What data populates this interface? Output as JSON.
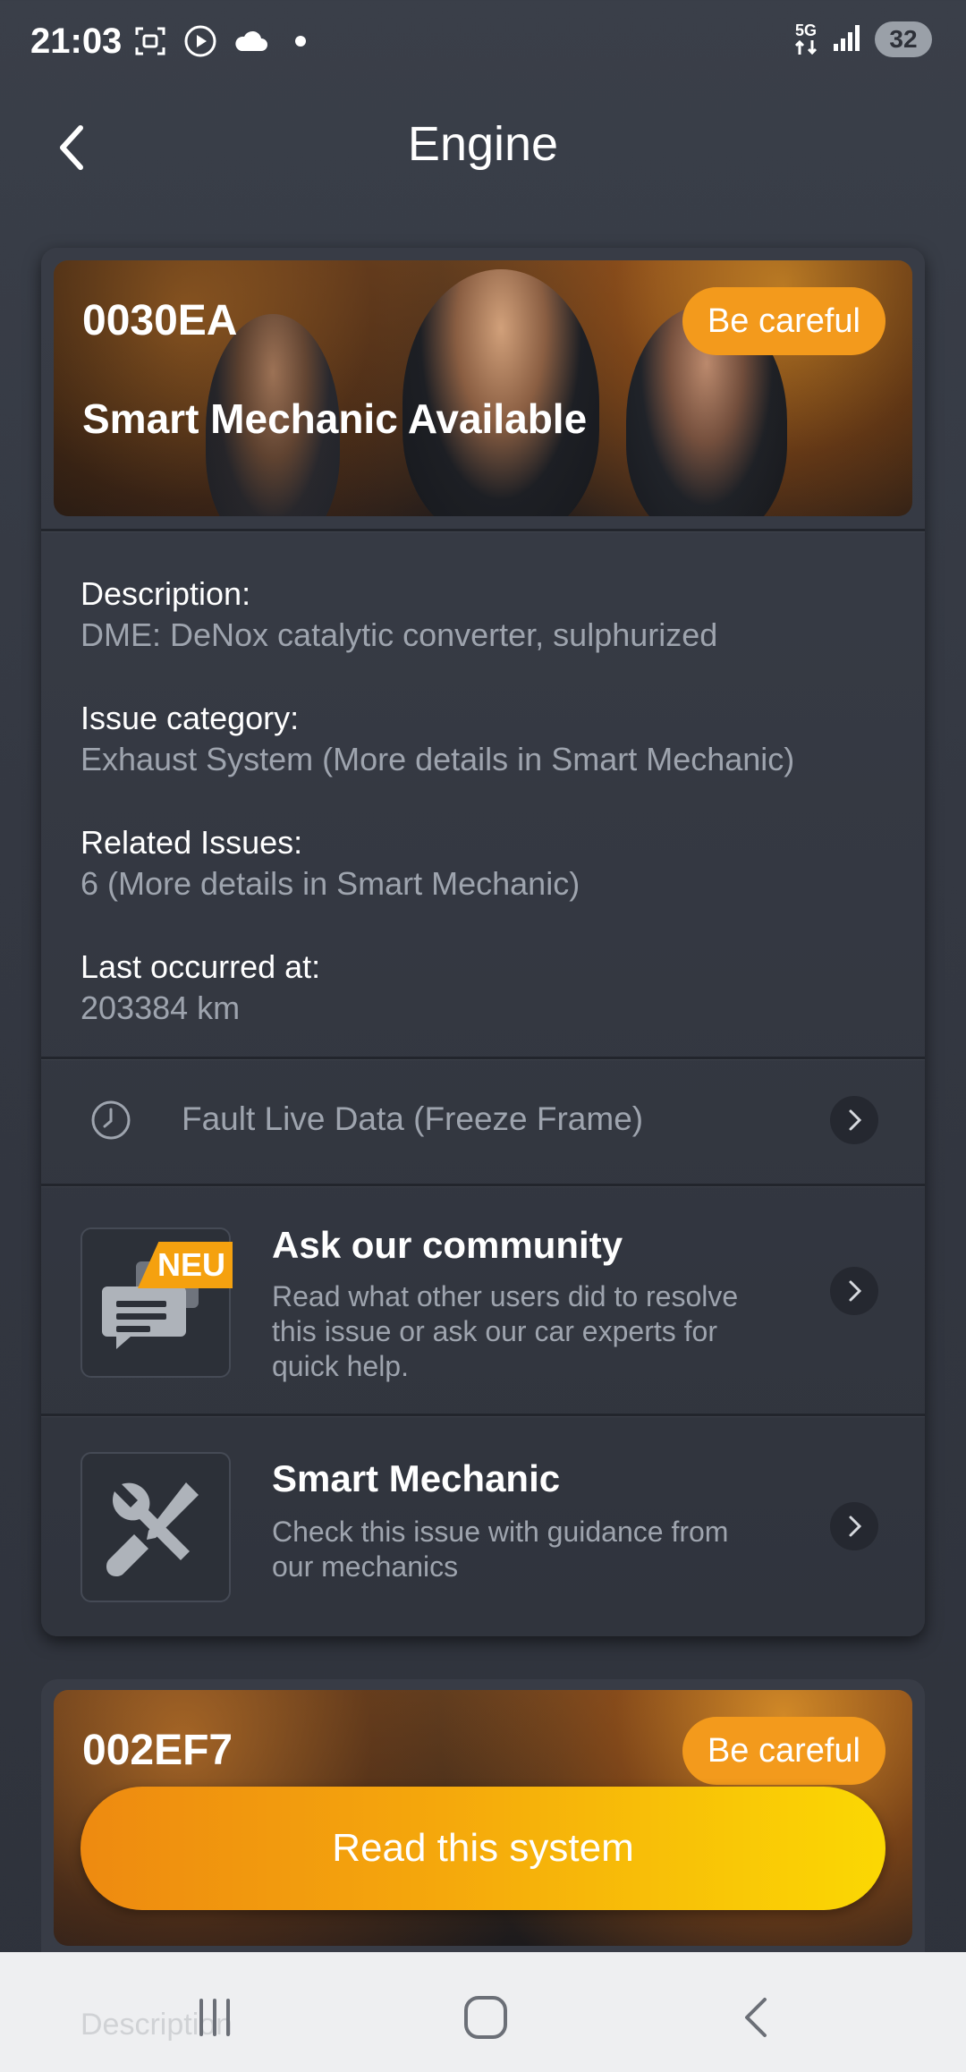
{
  "status_bar": {
    "time": "21:03",
    "network": "5G",
    "battery": "32",
    "icons": [
      "screenshot-icon",
      "play-icon",
      "cloud-icon",
      "dot-icon",
      "network-icon",
      "signal-icon",
      "battery-icon"
    ]
  },
  "header": {
    "title": "Engine",
    "back_icon": "chevron-left-icon"
  },
  "fault_card": {
    "code": "0030EA",
    "subtitle": "Smart Mechanic Available",
    "badge": "Be careful",
    "badge_color": "#f39a1c",
    "description_label": "Description:",
    "description_value": "DME: DeNox catalytic converter, sulphurized",
    "category_label": "Issue category:",
    "category_value": "Exhaust System (More details in Smart Mechanic)",
    "related_label": "Related Issues:",
    "related_value": "6 (More details in Smart Mechanic)",
    "last_label": "Last occurred at:",
    "last_value": "203384 km",
    "freeze_frame_label": "Fault Live Data (Freeze Frame)",
    "community": {
      "badge": "NEU",
      "title": "Ask our community",
      "desc": "Read what other users did to resolve this issue or ask our car experts for quick help."
    },
    "smart_mechanic": {
      "title": "Smart Mechanic",
      "desc": "Check this issue with guidance from our mechanics"
    }
  },
  "second_card": {
    "code": "002EF7",
    "badge": "Be careful"
  },
  "read_button": {
    "label": "Read this system"
  },
  "nav_bar": {
    "ghost_text": "Description"
  },
  "colors": {
    "accent_orange": "#f39a1c",
    "gradient_start": "#ee8a10",
    "gradient_end": "#fbd803",
    "background": "#343842"
  }
}
